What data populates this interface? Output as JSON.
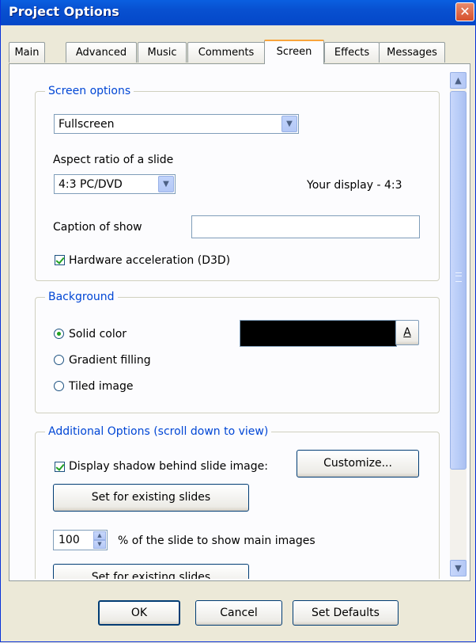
{
  "window": {
    "title": "Project Options",
    "close_glyph": "✕"
  },
  "tabs": [
    {
      "label": "Main"
    },
    {
      "label": "Advanced"
    },
    {
      "label": "Music"
    },
    {
      "label": "Comments"
    },
    {
      "label": "Screen",
      "active": true
    },
    {
      "label": "Effects"
    },
    {
      "label": "Messages"
    }
  ],
  "screen_options": {
    "group_label": "Screen options",
    "mode_value": "Fullscreen",
    "aspect_label": "Aspect ratio of a slide",
    "aspect_value": "4:3 PC/DVD",
    "display_info": "Your display - 4:3",
    "caption_label": "Caption of show",
    "caption_value": "",
    "hw_accel_label": "Hardware acceleration (D3D)",
    "hw_accel_checked": true
  },
  "background": {
    "group_label": "Background",
    "options": [
      {
        "label": "Solid color",
        "selected": true
      },
      {
        "label": "Gradient filling",
        "selected": false
      },
      {
        "label": "Tiled image",
        "selected": false
      }
    ],
    "color": "#000000",
    "color_button": "A"
  },
  "additional": {
    "group_label": "Additional Options (scroll down to view)",
    "shadow_label": "Display shadow behind slide image:",
    "shadow_checked": true,
    "customize_button": "Customize...",
    "set_existing_1": "Set for existing slides",
    "percent_value": "100",
    "percent_label": "% of the slide to show main images",
    "set_existing_2": "Set for existing slides"
  },
  "footer": {
    "ok": "OK",
    "cancel": "Cancel",
    "set_defaults": "Set Defaults"
  },
  "icons": {
    "dropdown": "chevron-down-icon",
    "scroll_up": "scroll-up-icon",
    "scroll_down": "scroll-down-icon"
  },
  "colors": {
    "title_bar": "#0a5fe0",
    "group_label": "#0046d5",
    "active_tab_accent": "#f8a43c",
    "checkmark": "#21a121"
  }
}
